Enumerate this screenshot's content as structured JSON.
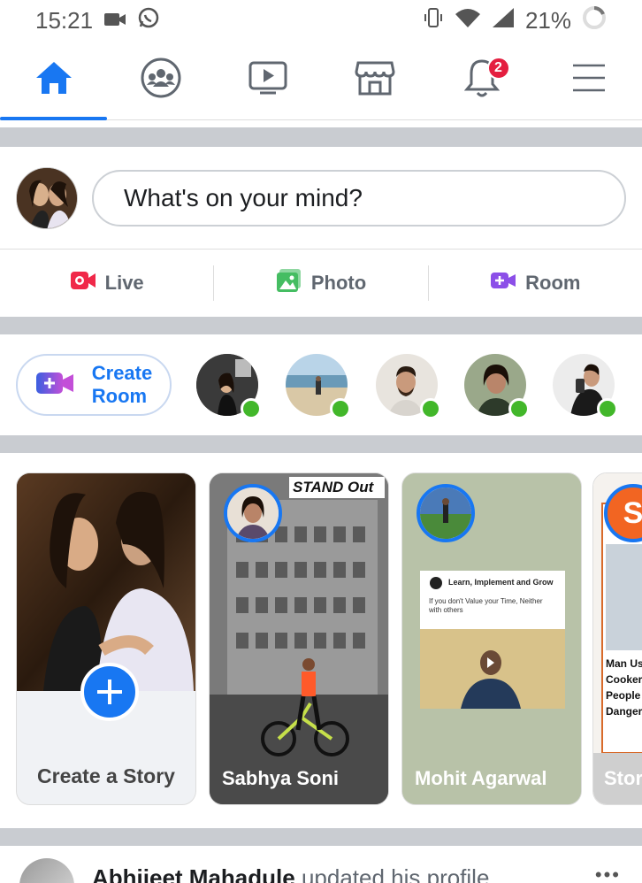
{
  "status_bar": {
    "time": "15:21",
    "battery": "21%"
  },
  "nav": {
    "tabs": [
      {
        "icon": "home-icon",
        "active": true
      },
      {
        "icon": "groups-icon",
        "active": false
      },
      {
        "icon": "watch-icon",
        "active": false
      },
      {
        "icon": "marketplace-icon",
        "active": false
      },
      {
        "icon": "notifications-icon",
        "badge": "2",
        "active": false
      },
      {
        "icon": "menu-icon",
        "active": false
      }
    ]
  },
  "composer": {
    "placeholder": "What's on your mind?"
  },
  "actions": {
    "live": "Live",
    "photo": "Photo",
    "room": "Room"
  },
  "rooms": {
    "create_line1": "Create",
    "create_line2": "Room"
  },
  "stories": {
    "create_label": "Create a Story",
    "items": [
      {
        "name": "Sabhya Soni",
        "overlay_text": "STAND Out"
      },
      {
        "name": "Mohit Agarwal",
        "card_title": "Learn, Implement and Grow",
        "card_text": "If you don't Value your Time, Neither with others"
      },
      {
        "name": "Stor",
        "headline": "Man Us Cooker People Danger"
      }
    ]
  },
  "post": {
    "author": "Abhijeet Mahadule",
    "action": "updated his profile"
  },
  "colors": {
    "brand_blue": "#1877f2",
    "live_red": "#f02849",
    "photo_green": "#45bd62",
    "room_purple": "#8c4fe8",
    "online_green": "#42b72a"
  }
}
